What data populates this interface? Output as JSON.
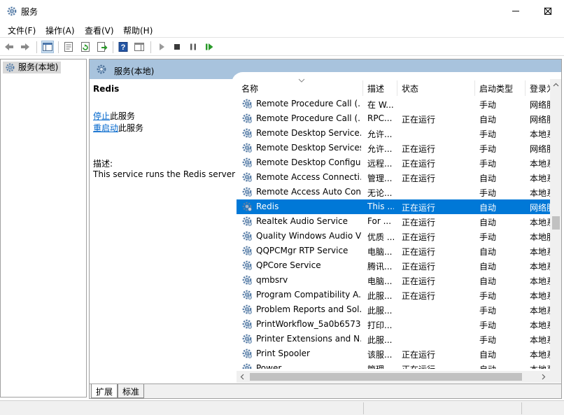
{
  "window": {
    "title": "服务"
  },
  "menu": [
    "文件(F)",
    "操作(A)",
    "查看(V)",
    "帮助(H)"
  ],
  "tree": {
    "root_label": "服务(本地)"
  },
  "content_header": {
    "title": "服务(本地)"
  },
  "details": {
    "service_name": "Redis",
    "stop_link": "停止",
    "stop_suffix": "此服务",
    "restart_link": "重启动",
    "restart_suffix": "此服务",
    "desc_label": "描述:",
    "desc_text": "This service runs the Redis server"
  },
  "columns": [
    "名称",
    "描述",
    "状态",
    "启动类型",
    "登录为"
  ],
  "rows": [
    {
      "name": "Remote Procedure Call (...",
      "desc": "在 W...",
      "status": "",
      "startup": "手动",
      "logon": "网络服务"
    },
    {
      "name": "Remote Procedure Call (...",
      "desc": "RPC...",
      "status": "正在运行",
      "startup": "自动",
      "logon": "网络服务"
    },
    {
      "name": "Remote Desktop Service...",
      "desc": "允许...",
      "status": "",
      "startup": "手动",
      "logon": "本地系统"
    },
    {
      "name": "Remote Desktop Services",
      "desc": "允许...",
      "status": "正在运行",
      "startup": "手动",
      "logon": "网络服务"
    },
    {
      "name": "Remote Desktop Configu...",
      "desc": "远程...",
      "status": "正在运行",
      "startup": "手动",
      "logon": "本地系统"
    },
    {
      "name": "Remote Access Connecti...",
      "desc": "管理...",
      "status": "正在运行",
      "startup": "自动",
      "logon": "本地系统"
    },
    {
      "name": "Remote Access Auto Con...",
      "desc": "无论...",
      "status": "",
      "startup": "手动",
      "logon": "本地系统"
    },
    {
      "name": "Redis",
      "desc": "This ...",
      "status": "正在运行",
      "startup": "自动",
      "logon": "网络服务",
      "selected": true
    },
    {
      "name": "Realtek Audio Service",
      "desc": "For ...",
      "status": "正在运行",
      "startup": "自动",
      "logon": "本地系统"
    },
    {
      "name": "Quality Windows Audio V...",
      "desc": "优质 ...",
      "status": "正在运行",
      "startup": "手动",
      "logon": "本地服务"
    },
    {
      "name": "QQPCMgr RTP Service",
      "desc": "电脑...",
      "status": "正在运行",
      "startup": "自动",
      "logon": "本地系统"
    },
    {
      "name": "QPCore Service",
      "desc": "腾讯...",
      "status": "正在运行",
      "startup": "自动",
      "logon": "本地系统"
    },
    {
      "name": "qmbsrv",
      "desc": "电脑...",
      "status": "正在运行",
      "startup": "自动",
      "logon": "本地系统"
    },
    {
      "name": "Program Compatibility A...",
      "desc": "此服...",
      "status": "正在运行",
      "startup": "手动",
      "logon": "本地系统"
    },
    {
      "name": "Problem Reports and Sol...",
      "desc": "此服...",
      "status": "",
      "startup": "手动",
      "logon": "本地系统"
    },
    {
      "name": "PrintWorkflow_5a0b6573",
      "desc": "打印...",
      "status": "",
      "startup": "手动",
      "logon": "本地系统"
    },
    {
      "name": "Printer Extensions and N...",
      "desc": "此服...",
      "status": "",
      "startup": "手动",
      "logon": "本地系统"
    },
    {
      "name": "Print Spooler",
      "desc": "该服...",
      "status": "正在运行",
      "startup": "自动",
      "logon": "本地系统"
    },
    {
      "name": "Power",
      "desc": "管理...",
      "status": "正在运行",
      "startup": "自动",
      "logon": "本地系统"
    }
  ],
  "tabs": [
    "扩展",
    "标准"
  ],
  "colors": {
    "selection": "#0078d7",
    "header_band": "#a8c3dd",
    "link": "#0066cc"
  }
}
